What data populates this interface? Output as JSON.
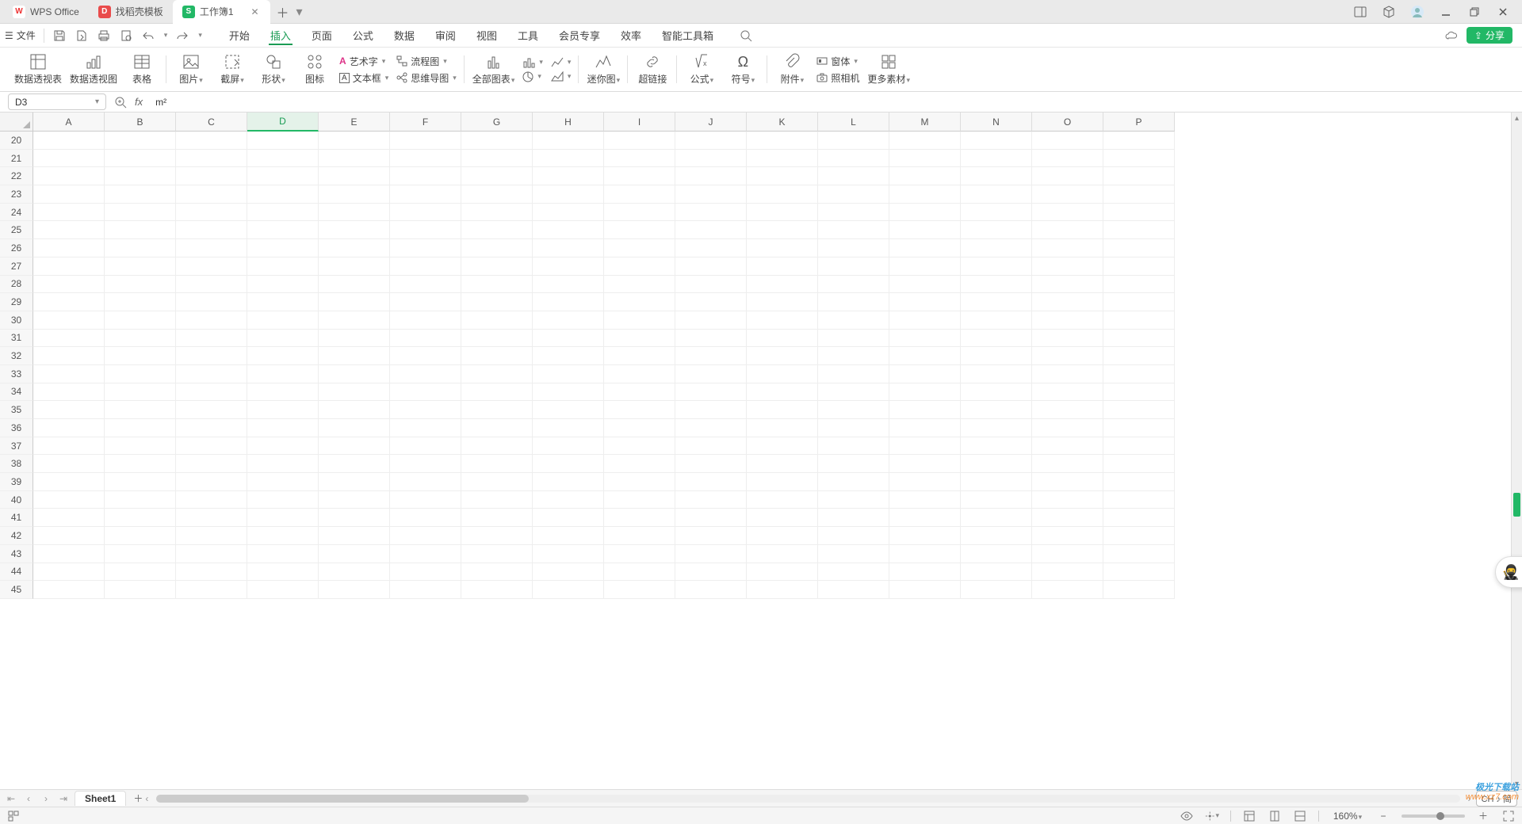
{
  "title_bar": {
    "app_name": "WPS Office",
    "template_tab": "找稻壳模板",
    "doc_tab": "工作簿1"
  },
  "menu": {
    "file_label": "文件",
    "tabs": [
      "开始",
      "插入",
      "页面",
      "公式",
      "数据",
      "审阅",
      "视图",
      "工具",
      "会员专享",
      "效率",
      "智能工具箱"
    ],
    "active_index": 1,
    "share_label": "分享"
  },
  "ribbon": {
    "pivot_table": "数据透视表",
    "pivot_chart": "数据透视图",
    "table": "表格",
    "picture": "图片",
    "screenshot": "截屏",
    "shape": "形状",
    "icon_lib": "图标",
    "wordart": "艺术字",
    "textbox": "文本框",
    "flowchart": "流程图",
    "mindmap": "思维导图",
    "all_charts": "全部图表",
    "sparkline": "迷你图",
    "hyperlink": "超链接",
    "formula": "公式",
    "symbol": "符号",
    "attachment": "附件",
    "camera": "照相机",
    "form": "窗体",
    "more_assets": "更多素材"
  },
  "namebox": {
    "value": "D3"
  },
  "formula": {
    "value": "m²"
  },
  "grid": {
    "columns": [
      "A",
      "B",
      "C",
      "D",
      "E",
      "F",
      "G",
      "H",
      "I",
      "J",
      "K",
      "L",
      "M",
      "N",
      "O",
      "P"
    ],
    "selected_col_index": 3,
    "row_start": 20,
    "row_end": 45
  },
  "sheet_tabs": {
    "active": "Sheet1"
  },
  "ime": "CH ♪ 简",
  "status": {
    "zoom": "160%"
  },
  "watermark": {
    "line1": "极光下载站",
    "line2": "www.xz7.com"
  }
}
